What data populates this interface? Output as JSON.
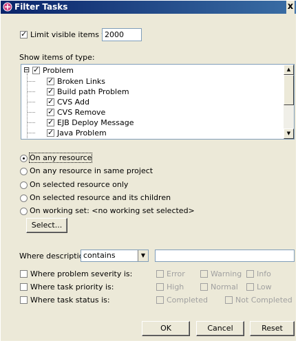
{
  "window": {
    "title": "Filter Tasks",
    "close_glyph": "x"
  },
  "limit": {
    "label": "Limit visible items to:",
    "value": "2000",
    "checked": true
  },
  "types": {
    "label": "Show items of type:",
    "root": {
      "label": "Problem",
      "checked": true,
      "expander": "⊟"
    },
    "items": [
      {
        "label": "Broken Links",
        "checked": true
      },
      {
        "label": "Build path Problem",
        "checked": true
      },
      {
        "label": "CVS Add",
        "checked": true
      },
      {
        "label": "CVS Remove",
        "checked": true
      },
      {
        "label": "EJB Deploy Message",
        "checked": true
      },
      {
        "label": "Java Problem",
        "checked": true
      }
    ]
  },
  "scope": {
    "options": [
      {
        "label": "On any resource",
        "selected": true
      },
      {
        "label": "On any resource in same project",
        "selected": false
      },
      {
        "label": "On selected resource only",
        "selected": false
      },
      {
        "label": "On selected resource and its children",
        "selected": false
      },
      {
        "label": "On working set:  <no working set selected>",
        "selected": false
      }
    ],
    "select_button": "Select..."
  },
  "description": {
    "label": "Where description",
    "operator": "contains",
    "value": ""
  },
  "severity": {
    "label": "Where problem severity is:",
    "options": [
      "Error",
      "Warning",
      "Info"
    ]
  },
  "priority": {
    "label": "Where task priority is:",
    "options": [
      "High",
      "Normal",
      "Low"
    ]
  },
  "status": {
    "label": "Where task status is:",
    "options": [
      "Completed",
      "Not Completed"
    ]
  },
  "buttons": {
    "ok": "OK",
    "cancel": "Cancel",
    "reset": "Reset"
  },
  "colors": {
    "titlebar_start": "#0a246a",
    "titlebar_end": "#3a6ea5",
    "dialog_bg": "#ece9d8"
  }
}
